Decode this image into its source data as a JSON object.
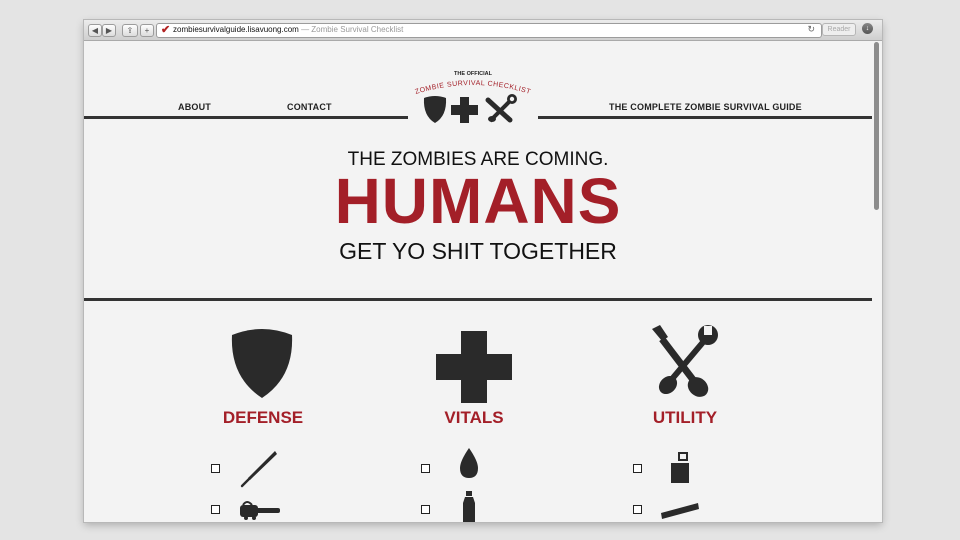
{
  "browser": {
    "url_domain": "zombiesurvivalguide.lisavuong.com",
    "url_separator": " — ",
    "page_title": "Zombie Survival Checklist",
    "reader_label": "Reader",
    "back_glyph": "◀",
    "forward_glyph": "▶",
    "share_glyph": "⇪",
    "add_glyph": "+",
    "reload_glyph": "↻",
    "favicon_glyph": "✔",
    "download_glyph": "↓"
  },
  "nav": {
    "about": "ABOUT",
    "contact": "CONTACT",
    "guide": "THE COMPLETE ZOMBIE SURVIVAL GUIDE"
  },
  "logo": {
    "official": "THE OFFICIAL",
    "name": "ZOMBIE SURVIVAL CHECKLIST"
  },
  "hero": {
    "line1": "THE ZOMBIES ARE COMING.",
    "big": "HUMANS",
    "line3": "GET YO SHIT TOGETHER"
  },
  "categories": [
    {
      "title": "DEFENSE",
      "icon": "shield-icon",
      "items": [
        "baseball-bat-icon",
        "chainsaw-icon"
      ]
    },
    {
      "title": "VITALS",
      "icon": "cross-icon",
      "items": [
        "water-drop-icon",
        "water-bottle-icon"
      ]
    },
    {
      "title": "UTILITY",
      "icon": "tools-icon",
      "items": [
        "lighter-icon",
        "crowbar-icon"
      ]
    }
  ],
  "colors": {
    "accent": "#a31f28",
    "ink": "#2a2a2a",
    "background": "#f3f3f3"
  }
}
